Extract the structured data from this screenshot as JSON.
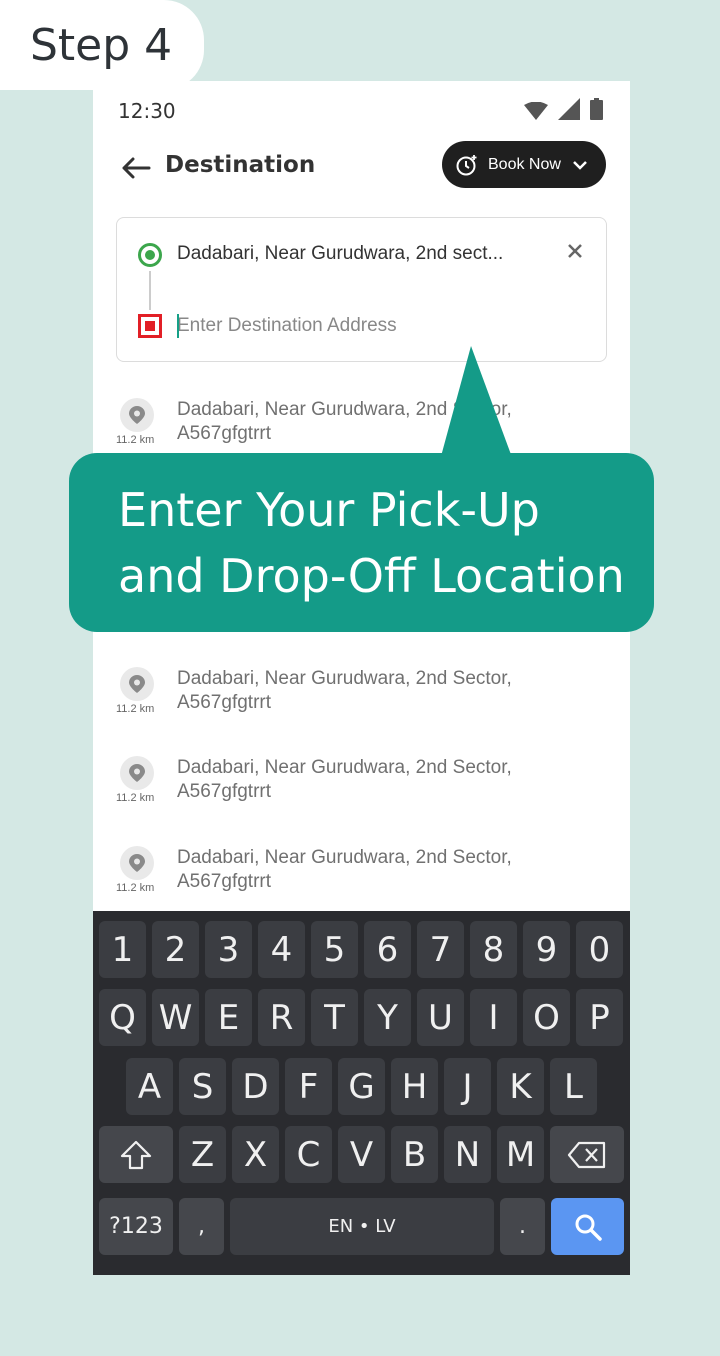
{
  "step": {
    "label": "Step 4"
  },
  "status": {
    "time": "12:30"
  },
  "header": {
    "title": "Destination",
    "book_now": "Book Now"
  },
  "address": {
    "pickup": "Dadabari, Near Gurudwara, 2nd sect...",
    "destination_value": "",
    "destination_placeholder": "Enter Destination Address"
  },
  "suggestions": [
    {
      "distance": "11.2 km",
      "line1": "Dadabari, Near Gurudwara, 2nd Sector,",
      "line2": "A567gfgtrrt"
    },
    {
      "distance": "11.2 km",
      "line1": "Dadabari, Near Gurudwara, 2nd Sector,",
      "line2": "A567gfgtrrt"
    },
    {
      "distance": "11.2 km",
      "line1": "Dadabari, Near Gurudwara, 2nd Sector,",
      "line2": "A567gfgtrrt"
    },
    {
      "distance": "11.2 km",
      "line1": "Dadabari, Near Gurudwara, 2nd Sector,",
      "line2": "A567gfgtrrt"
    }
  ],
  "tooltip": {
    "line1": "Enter Your Pick-Up",
    "line2": "and Drop-Off Location"
  },
  "keyboard": {
    "numbers": [
      "1",
      "2",
      "3",
      "4",
      "5",
      "6",
      "7",
      "8",
      "9",
      "0"
    ],
    "row1": [
      "Q",
      "W",
      "E",
      "R",
      "T",
      "Y",
      "U",
      "I",
      "O",
      "P"
    ],
    "row2": [
      "A",
      "S",
      "D",
      "F",
      "G",
      "H",
      "J",
      "K",
      "L"
    ],
    "row3": [
      "Z",
      "X",
      "C",
      "V",
      "B",
      "N",
      "M"
    ],
    "symbols_key": "?123",
    "comma_key": ",",
    "space_label": "EN • LV",
    "period_key": "."
  },
  "colors": {
    "accent": "#149b88",
    "pickup": "#3ca64c",
    "drop": "#e21f26",
    "search_key": "#5b96f2"
  }
}
